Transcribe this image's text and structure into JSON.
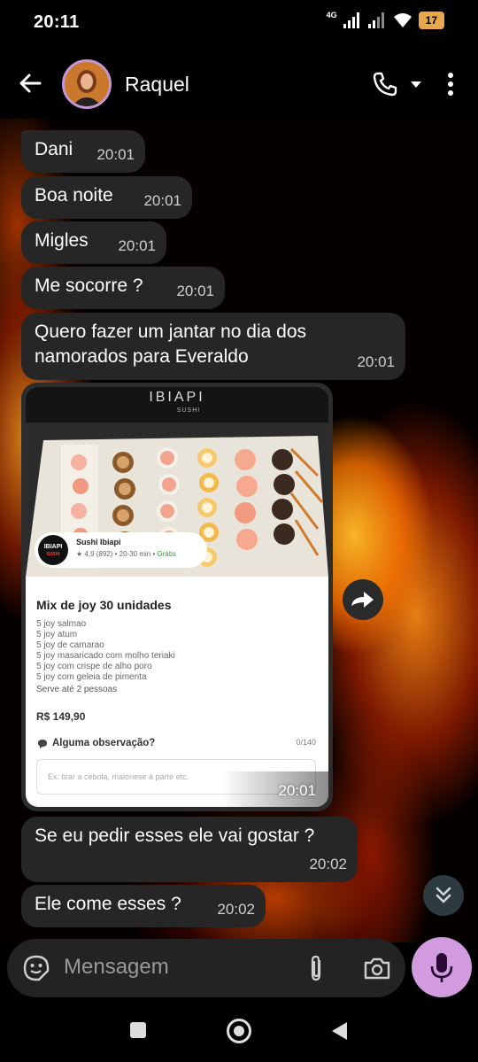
{
  "status_bar": {
    "time": "20:11",
    "network": "4G",
    "battery": "17"
  },
  "header": {
    "contact_name": "Raquel"
  },
  "messages": [
    {
      "text": "Dani",
      "time": "20:01"
    },
    {
      "text": "Boa noite",
      "time": "20:01"
    },
    {
      "text": "Migles",
      "time": "20:01"
    },
    {
      "text": "Me socorre ?",
      "time": "20:01"
    },
    {
      "line1": "Quero fazer um jantar no dia dos",
      "line2": "namorados para Everaldo",
      "time": "20:01"
    }
  ],
  "image_message": {
    "time": "20:01",
    "photo_sign": "IBIAPI",
    "photo_sign_sub": "SUSHI",
    "shop": {
      "logo": "IBIAPI",
      "logo_sub": "SUSHI",
      "name": "Sushi Ibiapi",
      "rating": "★ 4,9 (892) • 20-30 min • ",
      "delivery": "Grátis"
    },
    "product_title": "Mix de joy 30 unidades",
    "ingredients": [
      "5 joy salmao",
      "5 joy  atum",
      "5 joy de camarao",
      "5 joy masaricado com molho teriaki",
      "5 joy com crispe de alho poro",
      "5 joy com geleia de pimenta"
    ],
    "serves": "Serve até 2 pessoas",
    "price": "R$ 149,90",
    "obs_label": "Alguma observação?",
    "obs_count": "0/140",
    "obs_placeholder": "Ex: tirar a cebola, maionese à parte etc."
  },
  "messages_after": [
    {
      "text": "Se eu pedir esses ele vai gostar ?",
      "time": "20:02"
    },
    {
      "text": "Ele come esses ?",
      "time": "20:02"
    }
  ],
  "composer": {
    "placeholder": "Mensagem"
  },
  "colors": {
    "bubble": "#262626",
    "accent": "#d29be0",
    "battery": "#e8a74a"
  }
}
